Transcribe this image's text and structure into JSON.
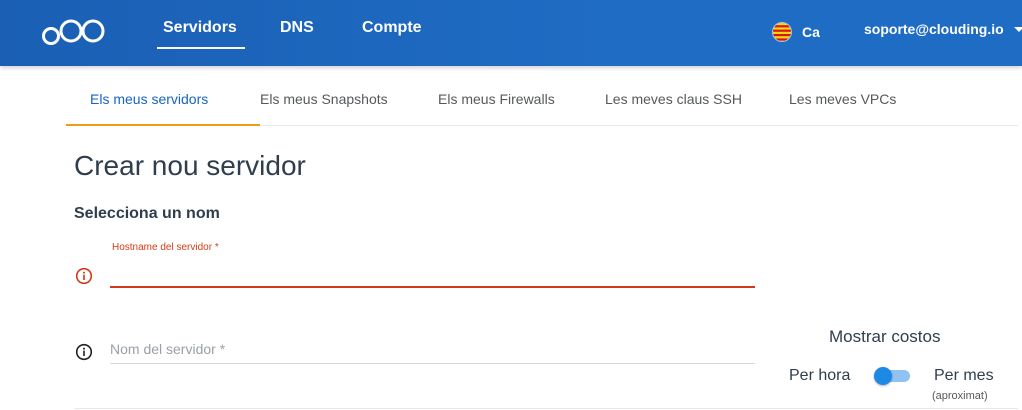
{
  "header": {
    "logo": "oOO",
    "nav": [
      {
        "label": "Servidors",
        "active": true
      },
      {
        "label": "DNS",
        "active": false
      },
      {
        "label": "Compte",
        "active": false
      }
    ],
    "language": {
      "code": "Ca",
      "flag_icon": "catalonia-flag-icon"
    },
    "user_email": "soporte@clouding.io"
  },
  "tabs": [
    {
      "label": "Els meus servidors",
      "active": true
    },
    {
      "label": "Els meus Snapshots",
      "active": false
    },
    {
      "label": "Els meus Firewalls",
      "active": false
    },
    {
      "label": "Les meves claus SSH",
      "active": false
    },
    {
      "label": "Les meves VPCs",
      "active": false
    }
  ],
  "main": {
    "title": "Crear nou servidor",
    "section_title": "Selecciona un nom",
    "hostname": {
      "label": "Hostname del servidor *",
      "value": "",
      "state": "error"
    },
    "server_name": {
      "placeholder": "Nom del servidor *",
      "value": ""
    }
  },
  "costs": {
    "title": "Mostrar costos",
    "per_hour_label": "Per hora",
    "per_month_label": "Per mes",
    "approx_label": "(aproximat)",
    "toggle_on": false
  },
  "colors": {
    "header_bg": "#1f6cc4",
    "active_tab_text": "#1565c0",
    "active_tab_underline": "#ef9c1a",
    "error": "#d0391a",
    "toggle_thumb": "#1e88e5"
  }
}
